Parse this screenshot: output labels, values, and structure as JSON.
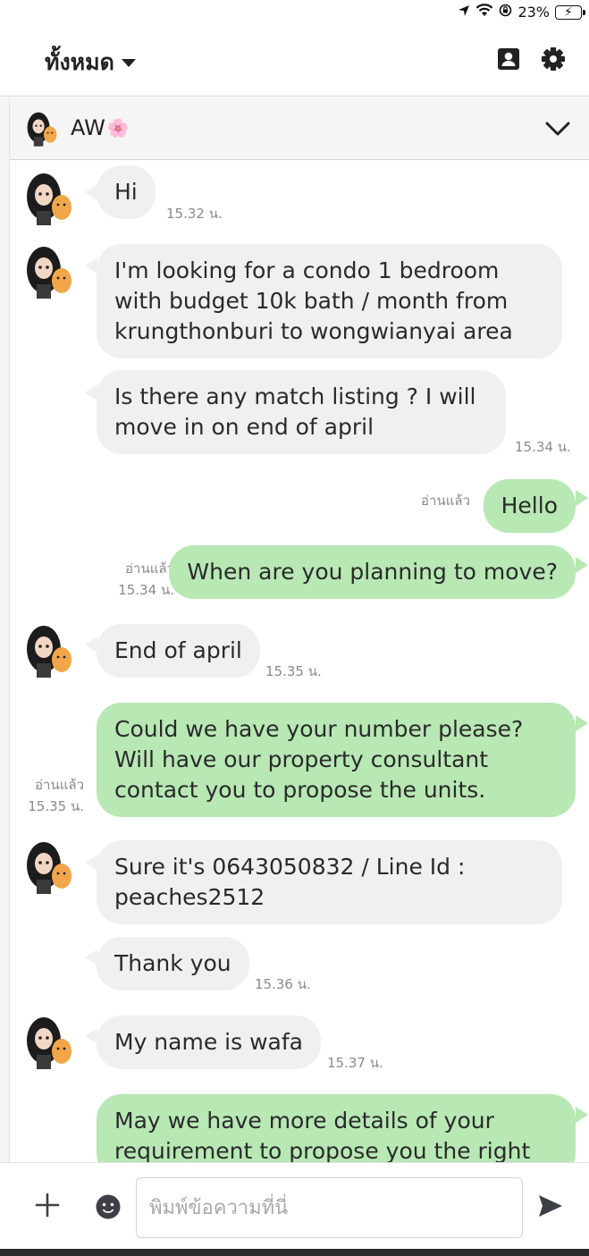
{
  "status_bar": {
    "battery": "23%"
  },
  "header": {
    "title": "ทั้งหมด"
  },
  "chat": {
    "name": "AW",
    "name_emoji": "🌸"
  },
  "messages": [
    {
      "from": "contact",
      "text": "Hi",
      "time": "15.32 น."
    },
    {
      "from": "contact",
      "text": "I'm looking for a condo 1 bedroom with budget 10k bath / month from krungthonburi to wongwianyai area"
    },
    {
      "from": "contact",
      "text": "Is there any match listing ? I will move in on end of april",
      "time": "15.34 น."
    },
    {
      "from": "me",
      "text": "Hello",
      "read": "อ่านแล้ว"
    },
    {
      "from": "me",
      "text": "When are you planning to move?",
      "read": "อ่านแล้ว",
      "time": "15.34 น."
    },
    {
      "from": "contact",
      "text": "End of april",
      "time": "15.35 น."
    },
    {
      "from": "me",
      "text": "Could we have your number please? Will have our property consultant contact you to propose the units.",
      "read": "อ่านแล้ว",
      "time": "15.35 น."
    },
    {
      "from": "contact",
      "text": "Sure it's 0643050832 / Line Id : peaches2512"
    },
    {
      "from": "contact",
      "text": "Thank you",
      "time": "15.36 น."
    },
    {
      "from": "contact",
      "text": "My name is wafa",
      "time": "15.37 น."
    },
    {
      "from": "me",
      "text": "May we have more details of your requirement to propose you the right"
    }
  ],
  "composer": {
    "placeholder": "พิมพ์ข้อความที่นี่"
  },
  "colors": {
    "outgoing_bubble": "#b8e8b4",
    "incoming_bubble": "#f0f0f2",
    "accent": "#4cd964"
  }
}
